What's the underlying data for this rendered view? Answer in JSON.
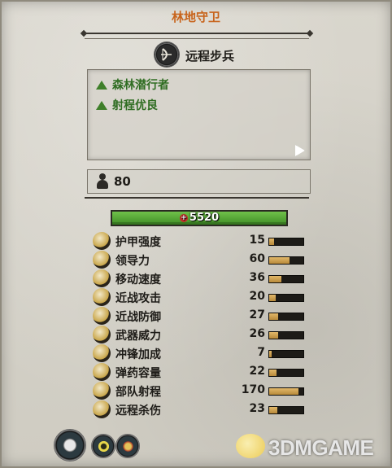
{
  "unit": {
    "name": "林地守卫",
    "class": "远程步兵",
    "class_icon": "bow-icon",
    "traits": [
      {
        "label": "森林潜行者",
        "icon": "green-triangle-icon"
      },
      {
        "label": "射程优良",
        "icon": "green-triangle-icon"
      }
    ],
    "unit_count": "80",
    "health": "5520"
  },
  "stats": [
    {
      "label": "护甲强度",
      "value": "15",
      "fill": 0.15
    },
    {
      "label": "领导力",
      "value": "60",
      "fill": 0.6
    },
    {
      "label": "移动速度",
      "value": "36",
      "fill": 0.36
    },
    {
      "label": "近战攻击",
      "value": "20",
      "fill": 0.2
    },
    {
      "label": "近战防御",
      "value": "27",
      "fill": 0.27
    },
    {
      "label": "武器威力",
      "value": "26",
      "fill": 0.26
    },
    {
      "label": "冲锋加成",
      "value": "7",
      "fill": 0.07
    },
    {
      "label": "弹药容量",
      "value": "22",
      "fill": 0.22
    },
    {
      "label": "部队射程",
      "value": "170",
      "fill": 0.85
    },
    {
      "label": "远程杀伤",
      "value": "23",
      "fill": 0.23
    }
  ],
  "stat_icons": [
    "armor-icon",
    "leadership-icon",
    "speed-icon",
    "melee-attack-icon",
    "melee-defence-icon",
    "weapon-strength-icon",
    "charge-bonus-icon",
    "ammunition-icon",
    "range-icon",
    "missile-damage-icon"
  ],
  "tabs": [
    {
      "icon": "skull-icon"
    },
    {
      "icon": "eye-icon"
    },
    {
      "icon": "campaign-icon"
    }
  ],
  "watermark": {
    "text": "3DMGAME"
  },
  "colors": {
    "title": "#c8641c",
    "trait": "#2f6d22",
    "health_bar": "#4fa02f",
    "stat_fill": "#d3a655"
  }
}
